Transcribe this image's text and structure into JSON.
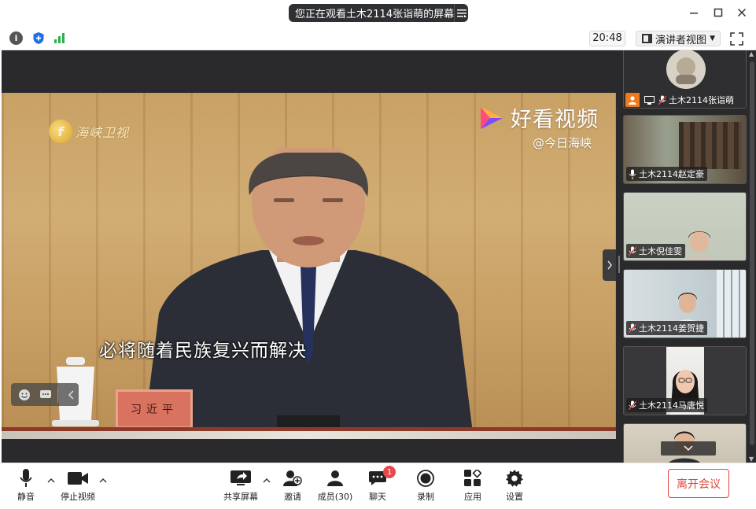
{
  "titlebar": {
    "share_banner": "您正在观看土木2114张诣萌的屏幕",
    "minimize": "minimize",
    "maximize": "maximize",
    "close": "close"
  },
  "infobar": {
    "clock": "20:48",
    "view_mode": "演讲者视图"
  },
  "stage": {
    "logo_left": "海峡卫视",
    "logo_right_brand": "好看视频",
    "logo_right_handle": "@今日海峡",
    "subtitle": "必将随着民族复兴而解决",
    "nameplate": "习近平"
  },
  "participants": [
    {
      "name": "土木2114张诣萌",
      "tile_bg": "#3b3b3d",
      "sharing": true
    },
    {
      "name": "土木2114赵定豪",
      "tile_bg": "#8a8f85"
    },
    {
      "name": "土木倪佳雯",
      "tile_bg": "#c9cfc2"
    },
    {
      "name": "土木2114姜贺捷",
      "tile_bg": "#c7d2d6"
    },
    {
      "name": "土木2114马唐悦",
      "tile_bg": "#3a3a3c"
    },
    {
      "name": "",
      "tile_bg": "#cfc9bc"
    }
  ],
  "toolbar": {
    "mute": "静音",
    "stop_video": "停止视频",
    "share_screen": "共享屏幕",
    "invite": "邀请",
    "members": "成员(30)",
    "chat": "聊天",
    "chat_badge": "1",
    "record": "录制",
    "apps": "应用",
    "settings": "设置",
    "leave": "离开会议"
  },
  "colors": {
    "leave_red": "#e0463f",
    "badge_red": "#e5484d",
    "stage_bg": "#2a2a2c"
  }
}
